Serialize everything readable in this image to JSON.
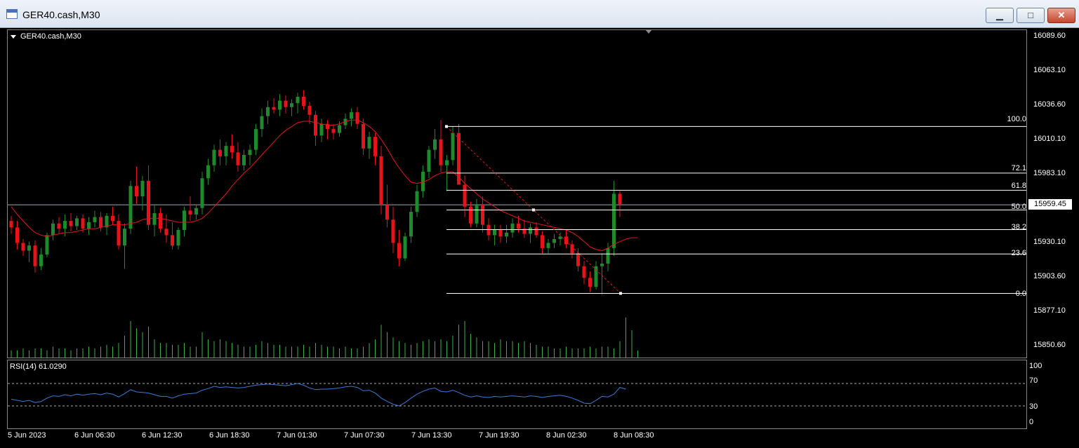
{
  "window": {
    "title": "GER40.cash,M30",
    "minimize_glyph": "▁",
    "maximize_glyph": "□",
    "close_glyph": "✕"
  },
  "chart": {
    "symbol_label": "GER40.cash,M30",
    "indicator_label": "RSI(14) 61.0290",
    "bid_price": "15959.45",
    "price_ticks": [
      "16089.60",
      "16063.10",
      "16036.60",
      "16010.10",
      "15983.10",
      "15959.45",
      "15930.10",
      "15903.60",
      "15877.10",
      "15850.60"
    ],
    "rsi_ticks": [
      "100",
      "70",
      "30",
      "0"
    ],
    "time_ticks": [
      "5 Jun 2023",
      "6 Jun 06:30",
      "6 Jun 12:30",
      "6 Jun 18:30",
      "7 Jun 01:30",
      "7 Jun 07:30",
      "7 Jun 13:30",
      "7 Jun 19:30",
      "8 Jun 02:30",
      "8 Jun 08:30"
    ],
    "fib_levels": [
      "100.0",
      "72.1",
      "61.8",
      "50.0",
      "38.2",
      "23.6",
      "0.0"
    ],
    "colors": {
      "bull": "#1f8a2b",
      "bear": "#e8121b",
      "ma": "#e8121b",
      "rsi": "#3a7bd5",
      "volume": "#3cb043",
      "grid": "#ffffff"
    }
  },
  "chart_data": {
    "type": "candlestick",
    "title": "GER40.cash,M30",
    "y_unit": "price",
    "ylim": [
      15840.0,
      16095.0
    ],
    "x_labels": [
      "5 Jun 2023",
      "6 Jun 06:30",
      "6 Jun 12:30",
      "6 Jun 18:30",
      "7 Jun 01:30",
      "7 Jun 07:30",
      "7 Jun 13:30",
      "7 Jun 19:30",
      "8 Jun 02:30",
      "8 Jun 08:30"
    ],
    "ohlc": [
      [
        15947,
        15951,
        15937,
        15942
      ],
      [
        15942,
        15947,
        15925,
        15930
      ],
      [
        15930,
        15933,
        15920,
        15924
      ],
      [
        15924,
        15931,
        15915,
        15928
      ],
      [
        15928,
        15932,
        15907,
        15912
      ],
      [
        15912,
        15926,
        15909,
        15921
      ],
      [
        15921,
        15938,
        15919,
        15936
      ],
      [
        15936,
        15948,
        15932,
        15945
      ],
      [
        15945,
        15950,
        15937,
        15941
      ],
      [
        15941,
        15952,
        15935,
        15947
      ],
      [
        15947,
        15953,
        15939,
        15943
      ],
      [
        15943,
        15951,
        15940,
        15949
      ],
      [
        15949,
        15952,
        15938,
        15941
      ],
      [
        15941,
        15950,
        15936,
        15946
      ],
      [
        15946,
        15955,
        15942,
        15950
      ],
      [
        15950,
        15954,
        15939,
        15942
      ],
      [
        15942,
        15953,
        15936,
        15951
      ],
      [
        15951,
        15958,
        15944,
        15947
      ],
      [
        15947,
        15952,
        15925,
        15928
      ],
      [
        15928,
        15945,
        15910,
        15941
      ],
      [
        15941,
        15978,
        15937,
        15974
      ],
      [
        15974,
        15989,
        15960,
        15966
      ],
      [
        15966,
        15982,
        15955,
        15978
      ],
      [
        15978,
        15990,
        15940,
        15944
      ],
      [
        15944,
        15960,
        15935,
        15953
      ],
      [
        15953,
        15957,
        15938,
        15941
      ],
      [
        15941,
        15952,
        15930,
        15936
      ],
      [
        15936,
        15946,
        15925,
        15928
      ],
      [
        15928,
        15942,
        15925,
        15940
      ],
      [
        15940,
        15958,
        15935,
        15955
      ],
      [
        15955,
        15966,
        15947,
        15952
      ],
      [
        15952,
        15960,
        15948,
        15957
      ],
      [
        15957,
        15985,
        15952,
        15980
      ],
      [
        15980,
        15995,
        15975,
        15990
      ],
      [
        15990,
        16006,
        15985,
        16002
      ],
      [
        16002,
        16010,
        15990,
        15997
      ],
      [
        15997,
        16008,
        15990,
        16005
      ],
      [
        16005,
        16014,
        15995,
        16000
      ],
      [
        16000,
        16008,
        15985,
        15990
      ],
      [
        15990,
        16002,
        15986,
        15998
      ],
      [
        15998,
        16006,
        15990,
        16002
      ],
      [
        16002,
        16022,
        15998,
        16018
      ],
      [
        16018,
        16034,
        16012,
        16028
      ],
      [
        16028,
        16040,
        16022,
        16035
      ],
      [
        16035,
        16042,
        16030,
        16033
      ],
      [
        16033,
        16045,
        16028,
        16040
      ],
      [
        16040,
        16044,
        16030,
        16035
      ],
      [
        16035,
        16041,
        16028,
        16038
      ],
      [
        16038,
        16046,
        16030,
        16043
      ],
      [
        16043,
        16048,
        16033,
        16036
      ],
      [
        16036,
        16039,
        16022,
        16029
      ],
      [
        16029,
        16032,
        16005,
        16013
      ],
      [
        16013,
        16026,
        16008,
        16022
      ],
      [
        16022,
        16025,
        16010,
        16018
      ],
      [
        16018,
        16022,
        16010,
        16015
      ],
      [
        16015,
        16024,
        16012,
        16021
      ],
      [
        16021,
        16030,
        16018,
        16026
      ],
      [
        16026,
        16034,
        16020,
        16031
      ],
      [
        16031,
        16035,
        16018,
        16022
      ],
      [
        16022,
        16026,
        15998,
        16003
      ],
      [
        16003,
        16016,
        15995,
        16012
      ],
      [
        16012,
        16015,
        15990,
        15997
      ],
      [
        15997,
        16005,
        15952,
        15960
      ],
      [
        15960,
        15975,
        15942,
        15948
      ],
      [
        15948,
        15958,
        15922,
        15930
      ],
      [
        15930,
        15940,
        15912,
        15918
      ],
      [
        15918,
        15938,
        15916,
        15935
      ],
      [
        15935,
        15958,
        15930,
        15954
      ],
      [
        15954,
        15975,
        15950,
        15970
      ],
      [
        15970,
        15990,
        15965,
        15985
      ],
      [
        15985,
        16005,
        15980,
        16002
      ],
      [
        16002,
        16018,
        15995,
        16010
      ],
      [
        16010,
        16025,
        15985,
        15990
      ],
      [
        15990,
        15998,
        15970,
        15994
      ],
      [
        15994,
        16020,
        15990,
        16015
      ],
      [
        16015,
        16022,
        15985,
        15975
      ],
      [
        15975,
        15982,
        15950,
        15958
      ],
      [
        15958,
        15962,
        15942,
        15945
      ],
      [
        15945,
        15964,
        15942,
        15960
      ],
      [
        15960,
        15966,
        15938,
        15944
      ],
      [
        15944,
        15949,
        15932,
        15936
      ],
      [
        15936,
        15944,
        15928,
        15940
      ],
      [
        15940,
        15944,
        15930,
        15935
      ],
      [
        15935,
        15944,
        15930,
        15938
      ],
      [
        15938,
        15949,
        15934,
        15945
      ],
      [
        15945,
        15951,
        15938,
        15941
      ],
      [
        15941,
        15948,
        15934,
        15937
      ],
      [
        15937,
        15945,
        15930,
        15942
      ],
      [
        15942,
        15946,
        15934,
        15936
      ],
      [
        15936,
        15939,
        15922,
        15926
      ],
      [
        15926,
        15933,
        15922,
        15930
      ],
      [
        15930,
        15937,
        15926,
        15933
      ],
      [
        15933,
        15938,
        15928,
        15935
      ],
      [
        15935,
        15940,
        15926,
        15929
      ],
      [
        15929,
        15932,
        15918,
        15922
      ],
      [
        15922,
        15926,
        15908,
        15912
      ],
      [
        15912,
        15916,
        15898,
        15903
      ],
      [
        15903,
        15908,
        15892,
        15896
      ],
      [
        15896,
        15916,
        15894,
        15912
      ],
      [
        15912,
        15922,
        15890,
        15914
      ],
      [
        15914,
        15930,
        15908,
        15926
      ],
      [
        15926,
        15978,
        15920,
        15968
      ],
      [
        15968,
        15970,
        15950,
        15960
      ]
    ],
    "volume": [
      4,
      4,
      5,
      4,
      5,
      5,
      4,
      6,
      5,
      5,
      4,
      5,
      5,
      6,
      5,
      6,
      7,
      6,
      8,
      12,
      20,
      16,
      14,
      17,
      10,
      8,
      8,
      7,
      7,
      8,
      6,
      6,
      14,
      10,
      9,
      10,
      9,
      8,
      7,
      6,
      6,
      7,
      9,
      8,
      7,
      7,
      6,
      6,
      6,
      7,
      6,
      8,
      7,
      6,
      6,
      5,
      6,
      5,
      5,
      6,
      8,
      10,
      18,
      14,
      11,
      9,
      8,
      7,
      8,
      9,
      10,
      9,
      10,
      9,
      12,
      18,
      20,
      13,
      11,
      9,
      9,
      8,
      10,
      9,
      9,
      8,
      9,
      8,
      7,
      6,
      6,
      5,
      5,
      6,
      5,
      5,
      5,
      6,
      5,
      6,
      6,
      5,
      9,
      22,
      15,
      4
    ],
    "sma": [
      15958,
      15952,
      15947,
      15942,
      15938,
      15936,
      15935,
      15936,
      15937,
      15938,
      15938,
      15939,
      15940,
      15941,
      15941,
      15942,
      15943,
      15944,
      15944,
      15944,
      15945,
      15946,
      15948,
      15949,
      15949,
      15949,
      15948,
      15947,
      15946,
      15946,
      15946,
      15947,
      15949,
      15953,
      15958,
      15963,
      15968,
      15974,
      15979,
      15984,
      15988,
      15993,
      15998,
      16003,
      16008,
      16013,
      16017,
      16020,
      16023,
      16024,
      16024,
      16023,
      16022,
      16021,
      16021,
      16022,
      16024,
      16025,
      16025,
      16023,
      16020,
      16016,
      16010,
      16003,
      15995,
      15988,
      15982,
      15977,
      15976,
      15977,
      15979,
      15982,
      15984,
      15985,
      15985,
      15981,
      15976,
      15972,
      15968,
      15964,
      15961,
      15958,
      15955,
      15953,
      15951,
      15949,
      15947,
      15946,
      15945,
      15944,
      15943,
      15942,
      15941,
      15940,
      15938,
      15935,
      15931,
      15927,
      15925,
      15924,
      15926,
      15929,
      15931,
      15933,
      15934,
      15934
    ],
    "rsi": [
      42,
      40,
      38,
      40,
      36,
      38,
      44,
      48,
      47,
      50,
      48,
      51,
      49,
      51,
      52,
      50,
      53,
      51,
      46,
      52,
      59,
      55,
      54,
      53,
      50,
      47,
      47,
      44,
      48,
      51,
      52,
      53,
      58,
      61,
      65,
      63,
      64,
      63,
      62,
      63,
      65,
      67,
      68,
      69,
      68,
      67,
      66,
      68,
      70,
      67,
      62,
      59,
      60,
      60,
      61,
      62,
      64,
      65,
      63,
      57,
      58,
      53,
      44,
      38,
      33,
      30,
      36,
      44,
      51,
      56,
      60,
      62,
      56,
      55,
      58,
      54,
      49,
      46,
      48,
      46,
      45,
      47,
      46,
      47,
      48,
      47,
      46,
      48,
      47,
      45,
      47,
      48,
      49,
      47,
      44,
      40,
      35,
      34,
      40,
      47,
      46,
      51,
      63,
      60
    ],
    "fib": {
      "high": 16020.0,
      "low": 15891.0
    }
  }
}
